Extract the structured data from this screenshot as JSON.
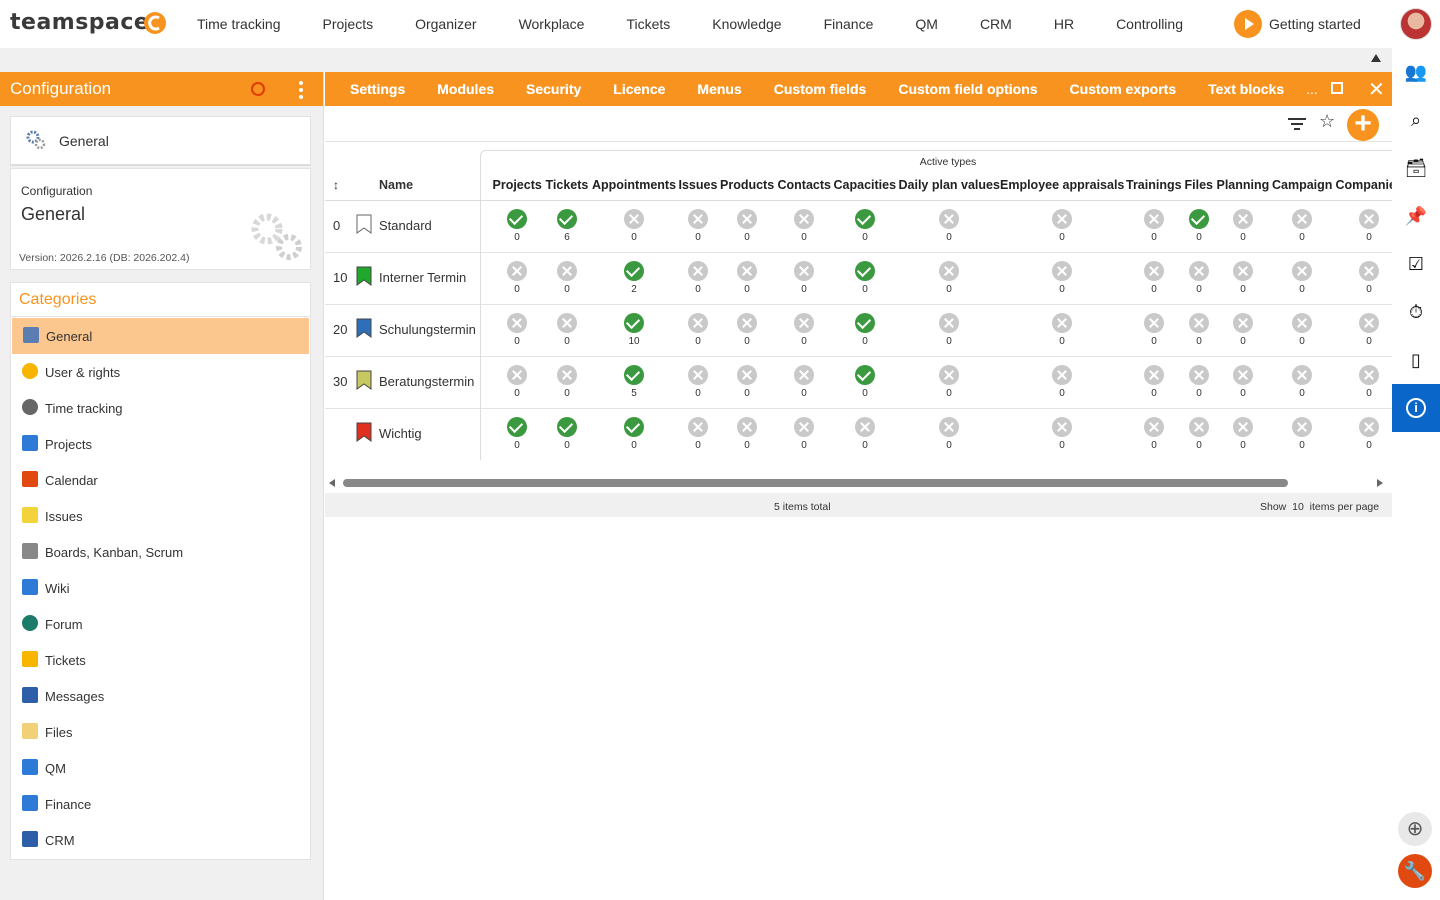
{
  "brand": {
    "logo_text": "teamspace",
    "accent": "#f7931e",
    "info_blue": "#0a66c8"
  },
  "nav": [
    "Time tracking",
    "Projects",
    "Organizer",
    "Workplace",
    "Tickets",
    "Knowledge",
    "Finance",
    "QM",
    "CRM",
    "HR",
    "Controlling"
  ],
  "getting_started": "Getting started",
  "left": {
    "header": "Configuration",
    "general_card": "General",
    "config_label": "Configuration",
    "config_value": "General",
    "version": "Version: 2026.2.16 (DB: 2026.202.4)",
    "categories_title": "Categories",
    "categories": [
      {
        "label": "General",
        "icon": "gears-icon",
        "color": "#5b7db1"
      },
      {
        "label": "User & rights",
        "icon": "users-icon",
        "color": "#f7b500"
      },
      {
        "label": "Time tracking",
        "icon": "stopwatch-icon",
        "color": "#666"
      },
      {
        "label": "Projects",
        "icon": "folder-icon",
        "color": "#2d7bd6"
      },
      {
        "label": "Calendar",
        "icon": "calendar-icon",
        "color": "#e04a10"
      },
      {
        "label": "Issues",
        "icon": "sticky-note-icon",
        "color": "#f2d43a"
      },
      {
        "label": "Boards, Kanban, Scrum",
        "icon": "kanban-icon",
        "color": "#888"
      },
      {
        "label": "Wiki",
        "icon": "wiki-icon",
        "color": "#2d7bd6"
      },
      {
        "label": "Forum",
        "icon": "forum-icon",
        "color": "#1c7a6b"
      },
      {
        "label": "Tickets",
        "icon": "ticket-icon",
        "color": "#f7b500"
      },
      {
        "label": "Messages",
        "icon": "messages-icon",
        "color": "#2d5fa8"
      },
      {
        "label": "Files",
        "icon": "files-icon",
        "color": "#f2d075"
      },
      {
        "label": "QM",
        "icon": "qm-icon",
        "color": "#2d7bd6"
      },
      {
        "label": "Finance",
        "icon": "finance-icon",
        "color": "#2d7bd6"
      },
      {
        "label": "CRM",
        "icon": "crm-icon",
        "color": "#2d5fa8"
      }
    ]
  },
  "tabs": [
    "Settings",
    "Modules",
    "Security",
    "Licence",
    "Menus",
    "Custom fields",
    "Custom field options",
    "Custom exports",
    "Text blocks"
  ],
  "tabs_more": "...",
  "grid": {
    "group_title": "Active types",
    "name_header": "Name",
    "columns": [
      "Projects",
      "Tickets",
      "Appointments",
      "Issues",
      "Products",
      "Contacts",
      "Capacities",
      "Daily plan values",
      "Employee appraisals",
      "Trainings",
      "Files",
      "Planning",
      "Campaign",
      "Companies"
    ],
    "rows": [
      {
        "num": "0",
        "name": "Standard",
        "flag_color": "#ffffff",
        "states": [
          1,
          1,
          0,
          0,
          0,
          0,
          1,
          0,
          0,
          0,
          1,
          0,
          0,
          0
        ],
        "counts": [
          "0",
          "6",
          "0",
          "0",
          "0",
          "0",
          "0",
          "0",
          "0",
          "0",
          "0",
          "0",
          "0",
          "0"
        ]
      },
      {
        "num": "10",
        "name": "Interner Termin",
        "flag_color": "#1fa82b",
        "states": [
          0,
          0,
          1,
          0,
          0,
          0,
          1,
          0,
          0,
          0,
          0,
          0,
          0,
          0
        ],
        "counts": [
          "0",
          "0",
          "2",
          "0",
          "0",
          "0",
          "0",
          "0",
          "0",
          "0",
          "0",
          "0",
          "0",
          "0"
        ]
      },
      {
        "num": "20",
        "name": "Schulungstermin",
        "flag_color": "#2d6fb8",
        "states": [
          0,
          0,
          1,
          0,
          0,
          0,
          1,
          0,
          0,
          0,
          0,
          0,
          0,
          0
        ],
        "counts": [
          "0",
          "0",
          "10",
          "0",
          "0",
          "0",
          "0",
          "0",
          "0",
          "0",
          "0",
          "0",
          "0",
          "0"
        ]
      },
      {
        "num": "30",
        "name": "Beratungstermin",
        "flag_color": "#c8c860",
        "states": [
          0,
          0,
          1,
          0,
          0,
          0,
          1,
          0,
          0,
          0,
          0,
          0,
          0,
          0
        ],
        "counts": [
          "0",
          "0",
          "5",
          "0",
          "0",
          "0",
          "0",
          "0",
          "0",
          "0",
          "0",
          "0",
          "0",
          "0"
        ]
      },
      {
        "num": "",
        "name": "Wichtig",
        "flag_color": "#e03020",
        "states": [
          1,
          1,
          1,
          0,
          0,
          0,
          0,
          0,
          0,
          0,
          0,
          0,
          0,
          0
        ],
        "counts": [
          "0",
          "0",
          "0",
          "0",
          "0",
          "0",
          "0",
          "0",
          "0",
          "0",
          "0",
          "0",
          "0",
          "0"
        ]
      }
    ],
    "total": "5 items total",
    "per_page_prefix": "Show",
    "per_page_value": "10",
    "per_page_suffix": "items per page"
  },
  "right_icons": [
    "contacts-icon",
    "search-icon",
    "inbox-icon",
    "pin-icon",
    "tasks-icon",
    "timer-icon",
    "mobile-icon",
    "info-icon",
    "add-circle-icon",
    "wrench-icon"
  ]
}
